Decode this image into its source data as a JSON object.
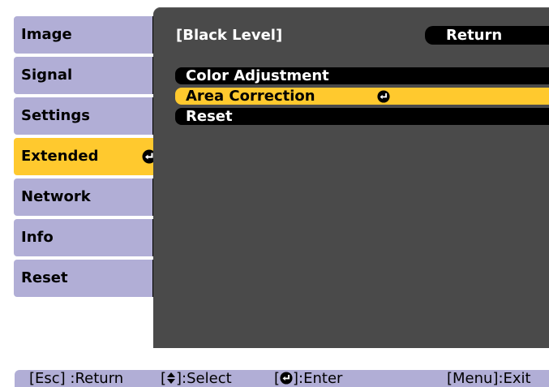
{
  "sidebar": {
    "items": [
      {
        "label": "Image"
      },
      {
        "label": "Signal"
      },
      {
        "label": "Settings"
      },
      {
        "label": "Extended",
        "selected": true
      },
      {
        "label": "Network"
      },
      {
        "label": "Info"
      },
      {
        "label": "Reset"
      }
    ]
  },
  "header": {
    "title": "[Black Level]",
    "return_label": "Return"
  },
  "menu": {
    "items": [
      {
        "label": "Color Adjustment"
      },
      {
        "label": "Area Correction",
        "selected": true
      },
      {
        "label": "Reset"
      }
    ]
  },
  "statusbar": {
    "esc": "[Esc] :Return",
    "select_pre": "[",
    "select_post": "]:Select",
    "enter_pre": "[",
    "enter_post": "]:Enter",
    "menu": "[Menu]:Exit"
  },
  "colors": {
    "highlight": "#ffc92e",
    "sidebar": "#b1aed6",
    "panel": "#4a4a4a"
  },
  "icons": {
    "enter": "enter-icon",
    "updown": "up-down-arrow-icon"
  }
}
